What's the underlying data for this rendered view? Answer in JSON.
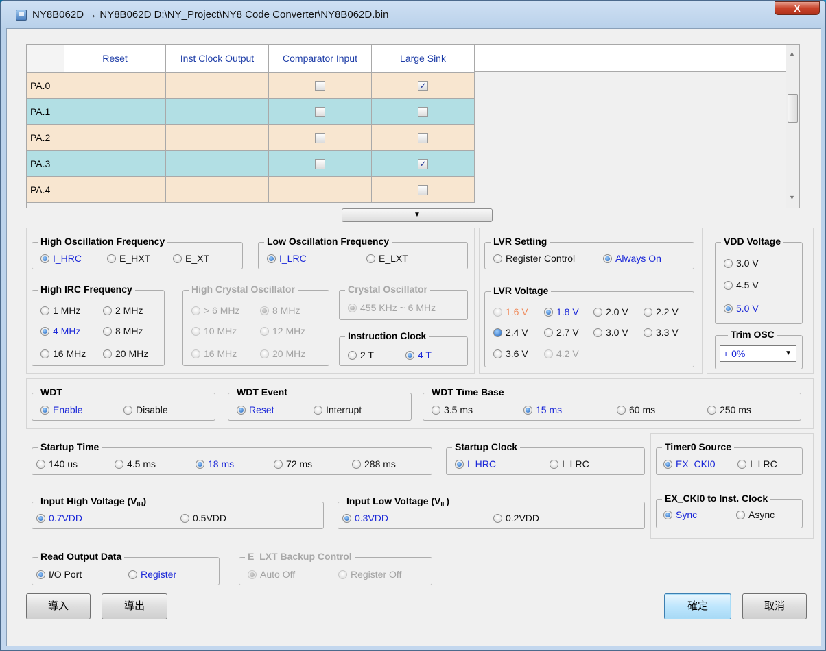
{
  "window": {
    "title": "NY8B062D → NY8B062D D:\\NY_Project\\NY8 Code Converter\\NY8B062D.bin",
    "close": "X"
  },
  "grid": {
    "headers": [
      "Reset",
      "Inst Clock Output",
      "Comparator Input",
      "Large Sink"
    ],
    "rows": [
      {
        "label": "PA.0",
        "comparator": false,
        "large_sink": true,
        "color": "#f8e6d0"
      },
      {
        "label": "PA.1",
        "comparator": false,
        "large_sink": false,
        "color": "#b2dfe4"
      },
      {
        "label": "PA.2",
        "comparator": false,
        "large_sink": false,
        "color": "#f8e6d0"
      },
      {
        "label": "PA.3",
        "comparator": false,
        "large_sink": true,
        "color": "#b2dfe4"
      },
      {
        "label": "PA.4",
        "comparator": null,
        "large_sink": false,
        "color": "#f8e6d0"
      }
    ],
    "check_mark": "✓"
  },
  "expand_icon": "▼",
  "hosc": {
    "caption": "High Oscillation Frequency",
    "options": [
      "I_HRC",
      "E_HXT",
      "E_XT"
    ]
  },
  "losc": {
    "caption": "Low Oscillation Frequency",
    "options": [
      "I_LRC",
      "E_LXT"
    ]
  },
  "hirc": {
    "caption": "High IRC Frequency",
    "options": [
      "1 MHz",
      "2 MHz",
      "4 MHz",
      "8 MHz",
      "16 MHz",
      "20 MHz"
    ]
  },
  "hxtal": {
    "caption": "High Crystal Oscillator",
    "options": [
      "> 6 MHz",
      "8 MHz",
      "10 MHz",
      "12 MHz",
      "16 MHz",
      "20 MHz"
    ]
  },
  "xtal": {
    "caption": "Crystal Oscillator",
    "options": [
      "455 KHz ~ 6 MHz"
    ]
  },
  "iclk": {
    "caption": "Instruction Clock",
    "options": [
      "2 T",
      "4 T"
    ]
  },
  "lvrset": {
    "caption": "LVR Setting",
    "options": [
      "Register Control",
      "Always On"
    ]
  },
  "lvrv": {
    "caption": "LVR Voltage",
    "options": [
      "1.6 V",
      "1.8 V",
      "2.0 V",
      "2.2 V",
      "2.4 V",
      "2.7 V",
      "3.0 V",
      "3.3 V",
      "3.6 V",
      "4.2 V"
    ]
  },
  "vdd": {
    "caption": "VDD Voltage",
    "options": [
      "3.0 V",
      "4.5 V",
      "5.0 V"
    ]
  },
  "trim": {
    "caption": "Trim OSC",
    "value": "+ 0%",
    "arrow": "▼"
  },
  "wdt": {
    "caption": "WDT",
    "options": [
      "Enable",
      "Disable"
    ]
  },
  "wdtev": {
    "caption": "WDT Event",
    "options": [
      "Reset",
      "Interrupt"
    ]
  },
  "wdttb": {
    "caption": "WDT Time Base",
    "options": [
      "3.5 ms",
      "15 ms",
      "60 ms",
      "250 ms"
    ]
  },
  "startup": {
    "caption": "Startup Time",
    "options": [
      "140 us",
      "4.5 ms",
      "18 ms",
      "72 ms",
      "288 ms"
    ]
  },
  "sclk": {
    "caption": "Startup Clock",
    "options": [
      "I_HRC",
      "I_LRC"
    ]
  },
  "t0": {
    "caption": "Timer0 Source",
    "options": [
      "EX_CKI0",
      "I_LRC"
    ]
  },
  "vih": {
    "caption_main": "Input High Voltage (V",
    "caption_sub": "IH",
    "caption_end": ")",
    "options": [
      "0.7VDD",
      "0.5VDD"
    ]
  },
  "vil": {
    "caption_main": "Input Low Voltage (V",
    "caption_sub": "IL",
    "caption_end": ")",
    "options": [
      "0.3VDD",
      "0.2VDD"
    ]
  },
  "exck": {
    "caption": "EX_CKI0 to Inst. Clock",
    "options": [
      "Sync",
      "Async"
    ]
  },
  "rod": {
    "caption": "Read Output Data",
    "options": [
      "I/O Port",
      "Register"
    ]
  },
  "elxt": {
    "caption": "E_LXT Backup Control",
    "options": [
      "Auto Off",
      "Register Off"
    ]
  },
  "buttons": {
    "import": "導入",
    "export": "導出",
    "ok": "確定",
    "cancel": "取消"
  }
}
